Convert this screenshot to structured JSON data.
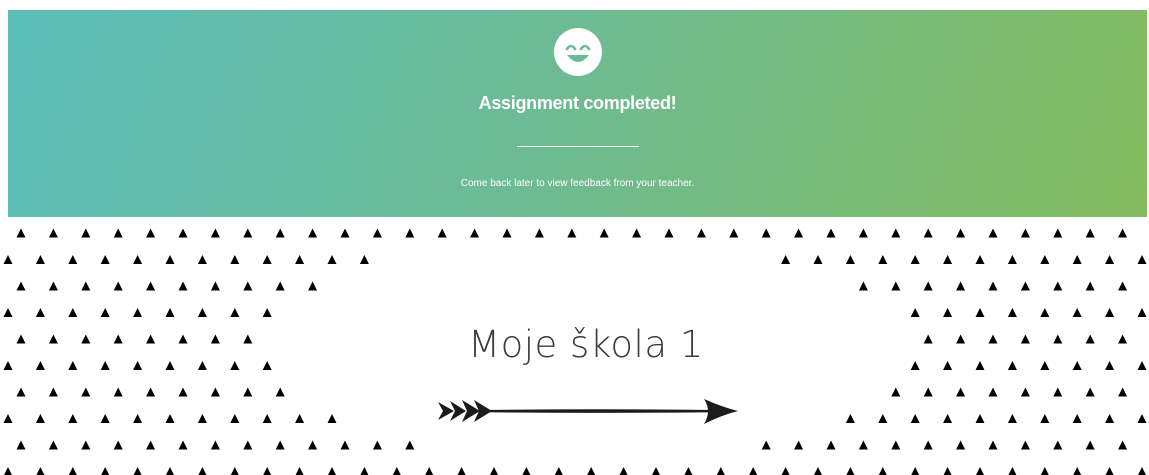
{
  "banner": {
    "icon": "smiley-face-icon",
    "title": "Assignment completed!",
    "subtitle": "Come back later to view feedback from your teacher.",
    "gradient_start": "#5bbdb8",
    "gradient_end": "#84bb5e"
  },
  "hero": {
    "title": "Moje škola 1",
    "pattern": "triangle-pattern",
    "arrow_icon": "arrow-right-icon",
    "pattern_color": "#000000"
  }
}
